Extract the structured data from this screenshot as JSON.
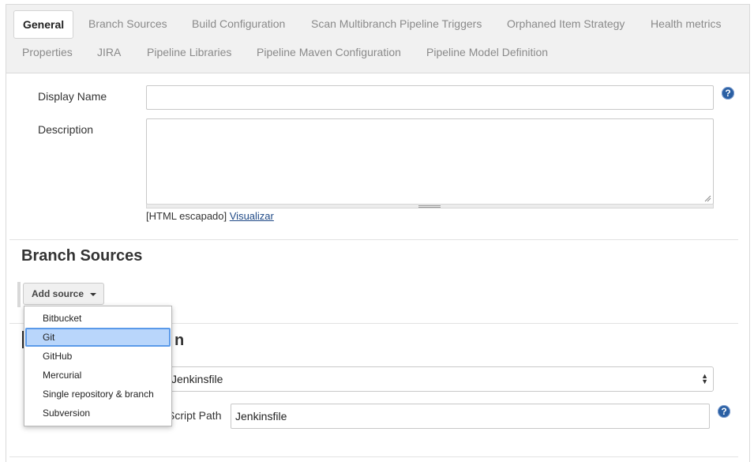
{
  "tabs": {
    "row1": [
      "General",
      "Branch Sources",
      "Build Configuration",
      "Scan Multibranch Pipeline Triggers",
      "Orphaned Item Strategy",
      "Health metrics"
    ],
    "row2": [
      "Properties",
      "JIRA",
      "Pipeline Libraries",
      "Pipeline Maven Configuration",
      "Pipeline Model Definition"
    ]
  },
  "general": {
    "display_name_label": "Display Name",
    "display_name_value": "",
    "description_label": "Description",
    "description_value": "",
    "html_escaped": "[HTML escapado]",
    "preview_link": "Visualizar",
    "help_glyph": "?"
  },
  "branch_sources": {
    "title": "Branch Sources",
    "add_source_label": "Add source"
  },
  "dropdown": {
    "items": [
      "Bitbucket",
      "Git",
      "GitHub",
      "Mercurial",
      "Single repository & branch",
      "Subversion"
    ],
    "selected": "Git"
  },
  "build_configuration": {
    "title_visible_tail": "n",
    "mode_select_visible": "Jenkinsfile",
    "script_path_label_visible": "Script Path",
    "script_path_value": "Jenkinsfile"
  },
  "colors": {
    "link": "#204a87",
    "help_icon": "#2a5fa3",
    "menu_selected_bg": "#b9d6fb",
    "menu_selected_border": "#5b9ae9"
  }
}
